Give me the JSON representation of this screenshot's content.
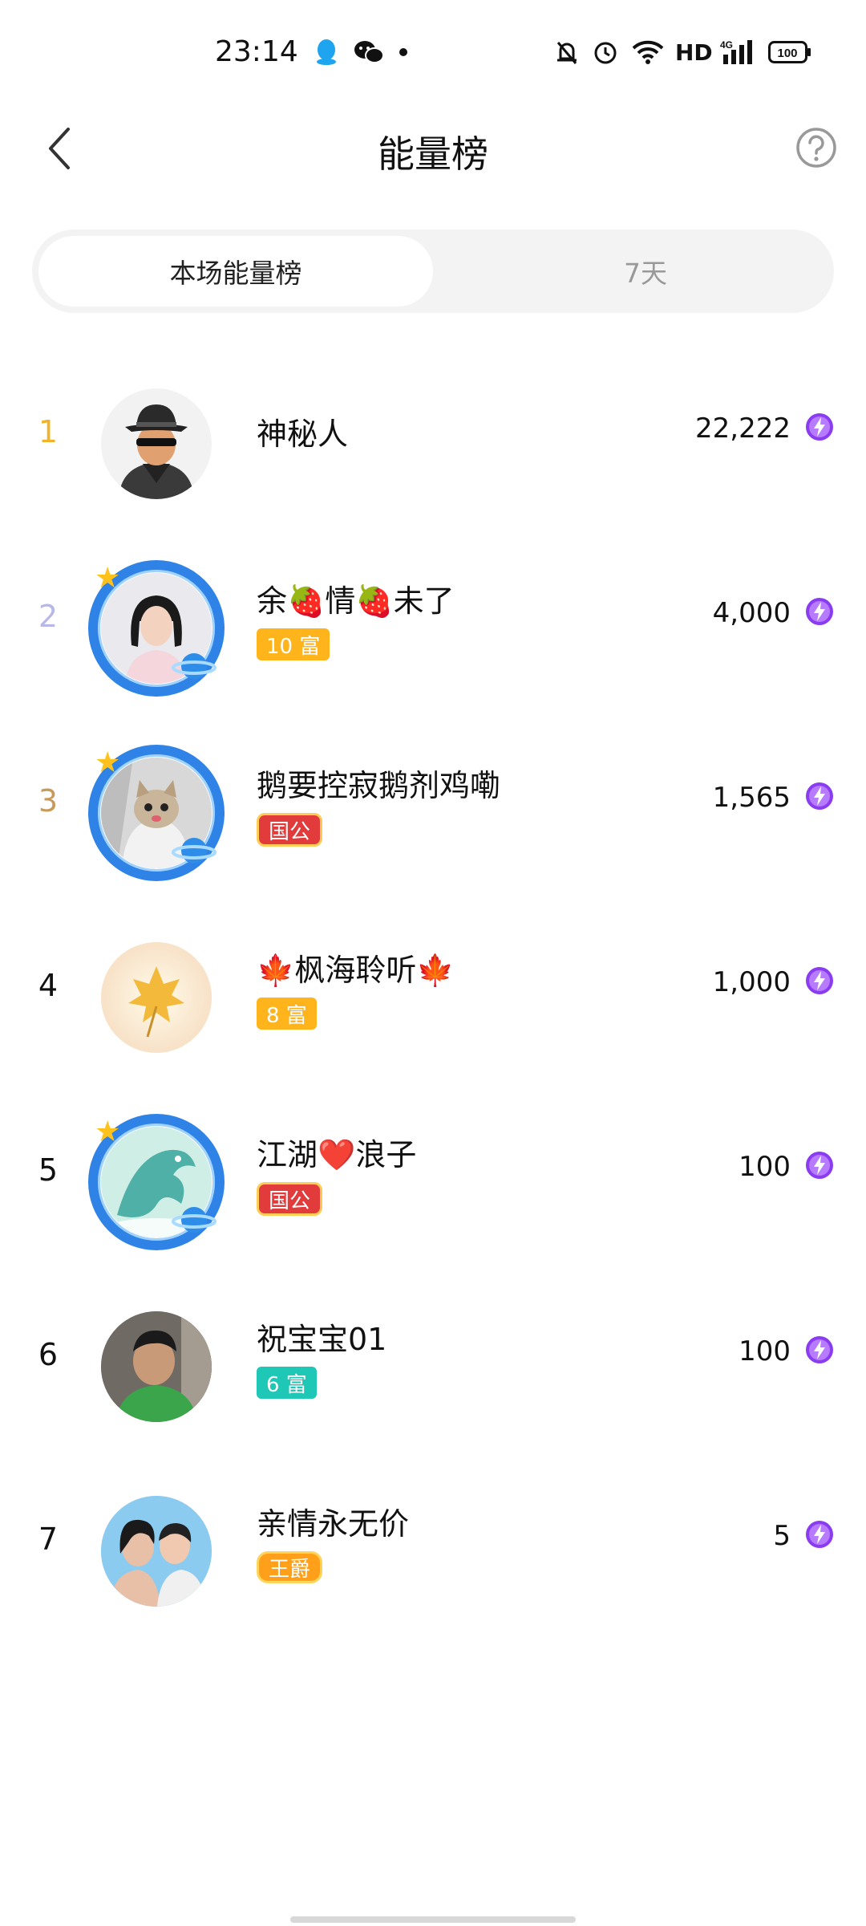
{
  "status_bar": {
    "time": "23:14",
    "icons": [
      "qq-icon",
      "wechat-icon",
      "notification-dot-icon",
      "mute-icon",
      "alarm-icon",
      "wifi-icon",
      "signal-4g-icon",
      "battery-icon"
    ],
    "hd_label": "HD",
    "network_label": "4G",
    "battery_label": "100"
  },
  "header": {
    "title": "能量榜",
    "back_icon": "chevron-left-icon",
    "help_icon": "question-circle-icon"
  },
  "tabs": [
    {
      "label": "本场能量榜",
      "active": true
    },
    {
      "label": "7天",
      "active": false
    }
  ],
  "ranking": [
    {
      "rank": "1",
      "nickname": "神秘人",
      "badge": "",
      "score": "22,222"
    },
    {
      "rank": "2",
      "nickname": "余🍓情🍓未了",
      "badge": "10 富",
      "score": "4,000"
    },
    {
      "rank": "3",
      "nickname": "鹅要控寂鹅剂鸡嘞",
      "badge": "国公",
      "score": "1,565"
    },
    {
      "rank": "4",
      "nickname": "🍁枫海聆听🍁",
      "badge": "8 富",
      "score": "1,000"
    },
    {
      "rank": "5",
      "nickname": "江湖❤️浪子",
      "badge": "国公",
      "score": "100"
    },
    {
      "rank": "6",
      "nickname": "祝宝宝01",
      "badge": "6 富",
      "score": "100"
    },
    {
      "rank": "7",
      "nickname": "亲情永无价",
      "badge": "王爵",
      "score": "5"
    }
  ],
  "colors": {
    "rank1": "#f0b32a",
    "rank2": "#b8b8e8",
    "rank3": "#c79a5a",
    "rank_default": "#111111",
    "bolt": "#8a3cf0",
    "badge_rich": "#ffb41c",
    "badge_rich_teal": "#1fc7b6",
    "badge_official": "#e23b3b",
    "badge_duke": "#ff9f1a"
  }
}
